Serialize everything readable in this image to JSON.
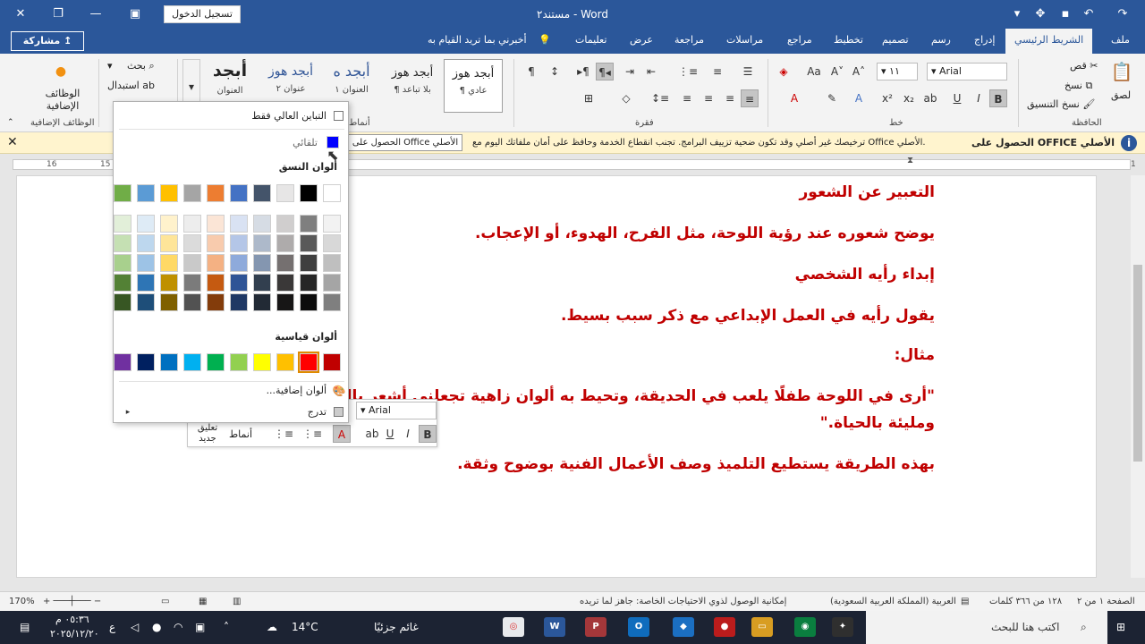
{
  "titlebar": {
    "doc_title": "مستند٢ - Word",
    "signin": "تسجيل الدخول"
  },
  "tabs": [
    "ملف",
    "الشريط الرئيسي",
    "إدراج",
    "رسم",
    "تصميم",
    "تخطيط",
    "مراجع",
    "مراسلات",
    "مراجعة",
    "عرض",
    "تعليمات",
    "أخبرني بما تريد القيام به"
  ],
  "share": "مشاركة",
  "ribbon": {
    "clipboard": {
      "paste": "لصق",
      "cut": "قص",
      "copy": "نسخ",
      "format_painter": "نسخ التنسيق",
      "group": "الحافظة"
    },
    "font": {
      "name": "Arial",
      "size": "١١",
      "group": "خط"
    },
    "paragraph": {
      "group": "فقرة"
    },
    "styles": {
      "items": [
        {
          "preview": "أبجد هوز",
          "name": "¶ عادي"
        },
        {
          "preview": "أبجد هوز",
          "name": "¶ بلا تباعد"
        },
        {
          "preview": "أبجد ه",
          "name": "العنوان ١"
        },
        {
          "preview": "أبجد هوز",
          "name": "عنوان ٢"
        },
        {
          "preview": "أبجد",
          "name": "العنوان"
        }
      ],
      "group": "أنماط"
    },
    "editing": {
      "find": "بحث",
      "replace": "استبدال"
    },
    "addins": {
      "label": "الوظائف الإضافية",
      "group": "الوظائف الإضافية"
    }
  },
  "notify": {
    "title": "الحصول على OFFICE الأصلي",
    "message": "ترخيصك غير أصلي وقد تكون ضحية تزييف البرامج. تجنب انقطاع الخدمة وحافظ على أمان ملفاتك اليوم مع Office الأصلي.",
    "button": "الحصول على Office الأصلي"
  },
  "ruler": [
    "16",
    "15",
    "1",
    "2",
    "3",
    "4",
    "5",
    "6",
    "7",
    "8",
    "9",
    "10",
    "11",
    "12",
    "13",
    "14",
    "15",
    "16",
    "17",
    "18"
  ],
  "document": {
    "paragraphs": [
      "التعبير عن الشعور",
      "يوضح شعوره عند رؤية اللوحة، مثل الفرح، الهدوء، أو الإعجاب.",
      "إبداء رأيه الشخصي",
      "يقول رأيه في العمل الإبداعي مع ذكر سبب بسيط.",
      "مثال:",
      "\"أرى في اللوحة طفلًا يلعب في الحديقة، وتحيط به ألوان زاهية تجعلني أشعر بالسعادة",
      "ومليئة بالحياة.\"",
      "بهذه الطريقة يستطيع التلميذ وصف الأعمال الفنية بوضوح وثقة."
    ]
  },
  "picker": {
    "high_contrast": "التباين العالي فقط",
    "automatic": "تلقائي",
    "theme_colors": "ألوان النسق",
    "standard_colors": "ألوان قياسية",
    "more_colors": "ألوان إضافية...",
    "gradient": "تدرج",
    "theme_top": [
      "#ffffff",
      "#000000",
      "#e7e6e6",
      "#44546a",
      "#4472c4",
      "#ed7d31",
      "#a5a5a5",
      "#ffc000",
      "#5b9bd5",
      "#70ad47"
    ],
    "theme_shades": [
      [
        "#f2f2f2",
        "#7f7f7f",
        "#d0cece",
        "#d6dce4",
        "#d9e2f3",
        "#fbe5d6",
        "#ededed",
        "#fff2cc",
        "#deebf6",
        "#e2efd9"
      ],
      [
        "#d8d8d8",
        "#595959",
        "#aeabab",
        "#adb9ca",
        "#b4c6e7",
        "#f8cbad",
        "#dbdbdb",
        "#fee599",
        "#bdd7ee",
        "#c5e0b3"
      ],
      [
        "#bfbfbf",
        "#3f3f3f",
        "#757070",
        "#8496b0",
        "#8eaadb",
        "#f4b183",
        "#c9c9c9",
        "#ffd965",
        "#9dc3e6",
        "#a8d08d"
      ],
      [
        "#a5a5a5",
        "#262626",
        "#3a3838",
        "#323f4f",
        "#2f5496",
        "#c55a11",
        "#7b7b7b",
        "#bf9000",
        "#2e75b5",
        "#538135"
      ],
      [
        "#7f7f7f",
        "#0c0c0c",
        "#171616",
        "#222a35",
        "#1f3864",
        "#833c0b",
        "#525252",
        "#7f6000",
        "#1e4e79",
        "#375623"
      ]
    ],
    "standard": [
      "#c00000",
      "#ff0000",
      "#ffc000",
      "#ffff00",
      "#92d050",
      "#00b050",
      "#00b0f0",
      "#0070c0",
      "#002060",
      "#7030a0"
    ],
    "auto_color": "#0000ff"
  },
  "minitoolbar": {
    "font": "Arial",
    "styles": "أنماط",
    "new_comment": "تعليق جديد"
  },
  "status": {
    "page": "الصفحة ١ من ٢",
    "words": "١٢٨ من ٣٦٦ كلمات",
    "language": "العربية (المملكة العربية السعودية)",
    "accessibility": "إمكانية الوصول لذوي الاحتياجات الخاصة: جاهز لما تريده",
    "zoom": "170%"
  },
  "taskbar": {
    "search": "اكتب هنا للبحث",
    "weather": "غائم جزئيًا",
    "temp": "14°C",
    "time": "٠٥:٣٦ م",
    "date": "٢٠٢٥/١٢/٢٠",
    "lang": "ع"
  }
}
